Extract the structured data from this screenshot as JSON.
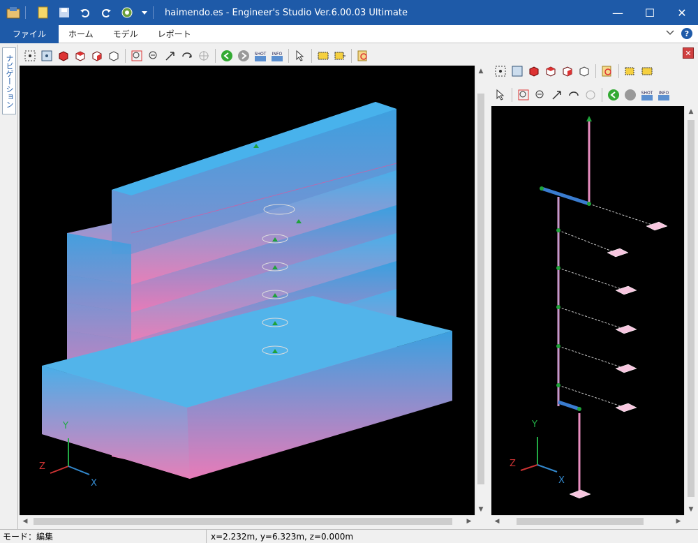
{
  "window": {
    "title": "haimendo.es - Engineer's Studio Ver.6.00.03 Ultimate",
    "controls": {
      "minimize": "—",
      "maximize": "☐",
      "close": "✕"
    }
  },
  "ribbon": {
    "tabs": [
      {
        "label": "ファイル",
        "active": true
      },
      {
        "label": "ホーム",
        "active": false
      },
      {
        "label": "モデル",
        "active": false
      },
      {
        "label": "レポート",
        "active": false
      }
    ],
    "help": "?"
  },
  "navigation": {
    "label": "ナビゲーション"
  },
  "toolbar_labels": {
    "shot": "SHOT",
    "info": "INFO"
  },
  "viewer": {
    "axes": {
      "y": "Y",
      "z": "Z",
      "x": "X"
    }
  },
  "status": {
    "mode": "モード：編集",
    "coords": "x=2.232m, y=6.323m, z=0.000m"
  },
  "colors": {
    "title_bar": "#1e5aa8",
    "model_blue": "#3aa0e0",
    "model_pink": "#e87bb8",
    "viewport_bg": "#000000",
    "node_green": "#1fa23a"
  }
}
